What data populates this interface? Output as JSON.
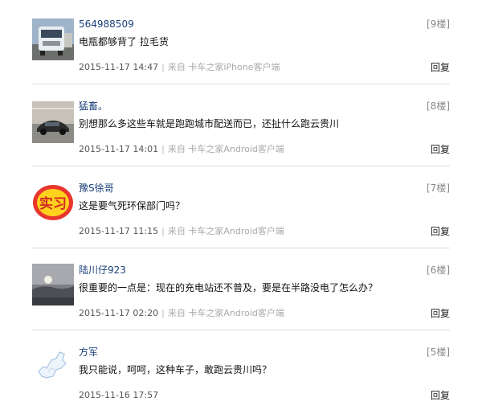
{
  "comments": [
    {
      "username": "564988509",
      "floor": "[9楼]",
      "text": "电瓶都够背了 拉毛货",
      "date": "2015-11-17 14:47",
      "separator": "|",
      "source": "来自 卡车之家iPhone客户端",
      "reply": "回复",
      "avatar_icon": "truck-photo-icon"
    },
    {
      "username": "猛畜。",
      "floor": "[8楼]",
      "text": "别想那么多这些车就是跑跑城市配送而已，还扯什么跑云贵川",
      "date": "2015-11-17 14:01",
      "separator": "|",
      "source": "来自 卡车之家Android客户端",
      "reply": "回复",
      "avatar_icon": "sports-car-photo-icon"
    },
    {
      "username": "豫S徐哥",
      "floor": "[7楼]",
      "text": "这是要气死环保部门吗？",
      "date": "2015-11-17 11:15",
      "separator": "|",
      "source": "来自 卡车之家Android客户端",
      "reply": "回复",
      "avatar_icon": "intern-badge-icon",
      "avatar_text": "实习"
    },
    {
      "username": "陆川仔923",
      "floor": "[6楼]",
      "text": "很重要的一点是：现在的充电站还不普及，要是在半路没电了怎么办？",
      "date": "2015-11-17 02:20",
      "separator": "|",
      "source": "来自 卡车之家Android客户端",
      "reply": "回复",
      "avatar_icon": "sunset-landscape-photo-icon"
    },
    {
      "username": "方军",
      "floor": "[5楼]",
      "text": "我只能说，呵呵，这种车子，敢跑云贵川吗？",
      "date": "2015-11-16 17:57",
      "separator": "",
      "source": "",
      "reply": "回复",
      "avatar_icon": "default-map-avatar-icon"
    }
  ]
}
